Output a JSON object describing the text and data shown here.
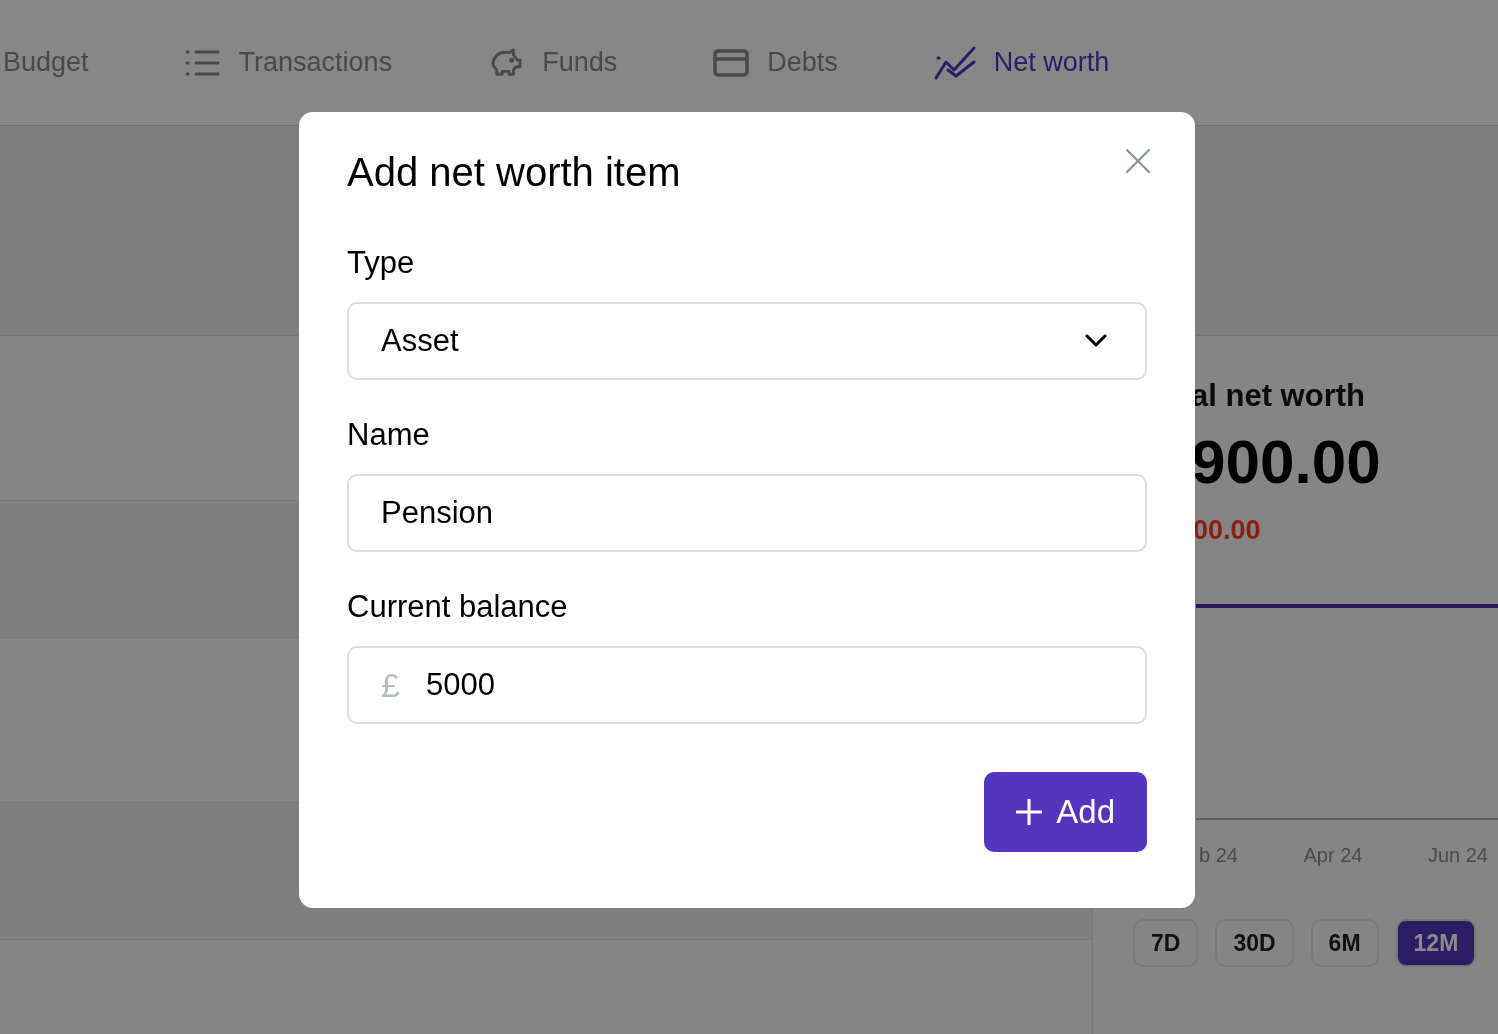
{
  "nav": {
    "tabs": [
      {
        "label": "Budget",
        "kind": "plain",
        "selected": false
      },
      {
        "label": "Transactions",
        "kind": "list",
        "selected": false
      },
      {
        "label": "Funds",
        "kind": "piggy",
        "selected": false
      },
      {
        "label": "Debts",
        "kind": "card",
        "selected": false
      },
      {
        "label": "Net worth",
        "kind": "chart",
        "selected": true
      }
    ]
  },
  "summary": {
    "title": "al net worth",
    "amount": "900.00",
    "change": "00.00",
    "x_labels": [
      "b 24",
      "Apr 24",
      "Jun 24"
    ],
    "ranges": [
      {
        "label": "7D",
        "selected": false
      },
      {
        "label": "30D",
        "selected": false
      },
      {
        "label": "6M",
        "selected": false
      },
      {
        "label": "12M",
        "selected": true
      }
    ]
  },
  "modal": {
    "title": "Add net worth item",
    "fields": [
      {
        "label": "Type",
        "kind": "select",
        "value": "Asset"
      },
      {
        "label": "Name",
        "kind": "text",
        "value": "Pension"
      },
      {
        "label": "Current balance",
        "kind": "currency",
        "prefix": "£",
        "value": "5000"
      }
    ],
    "submit": {
      "label": "Add"
    }
  }
}
